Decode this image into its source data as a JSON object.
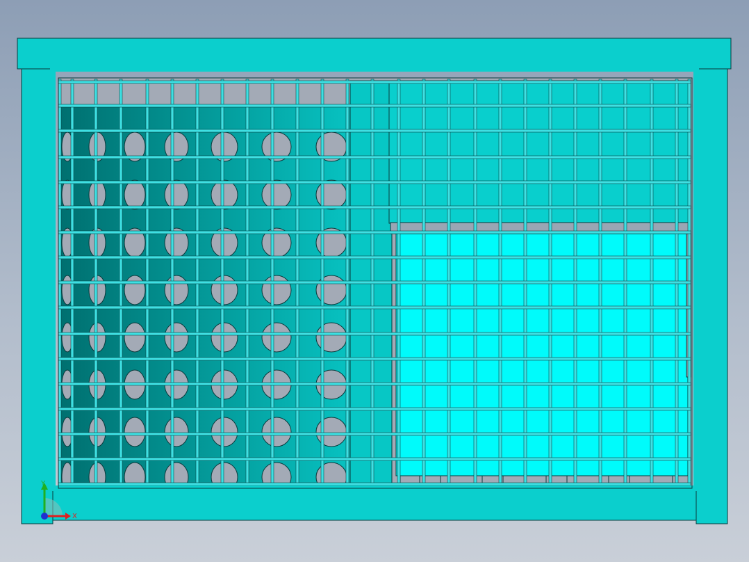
{
  "viewport": {
    "background_top": "#8d9eb5",
    "background_bottom": "#c9cfd8"
  },
  "model": {
    "frame_color": "#0bcfcd",
    "frame_edge_color": "#0a3a3c",
    "grid_color": "#3ee0e3",
    "grid_edge_color": "#0a4648",
    "cavity_color": "#a3aab6",
    "perforated_panel_dark": "#006f6f",
    "perforated_panel_light": "#07c2c1",
    "bright_panel_color": "#00fbfb"
  },
  "triad": {
    "x_label": "X",
    "y_label": "Y",
    "x_color": "#e02020",
    "y_color": "#20b020",
    "z_color": "#2030d0"
  }
}
